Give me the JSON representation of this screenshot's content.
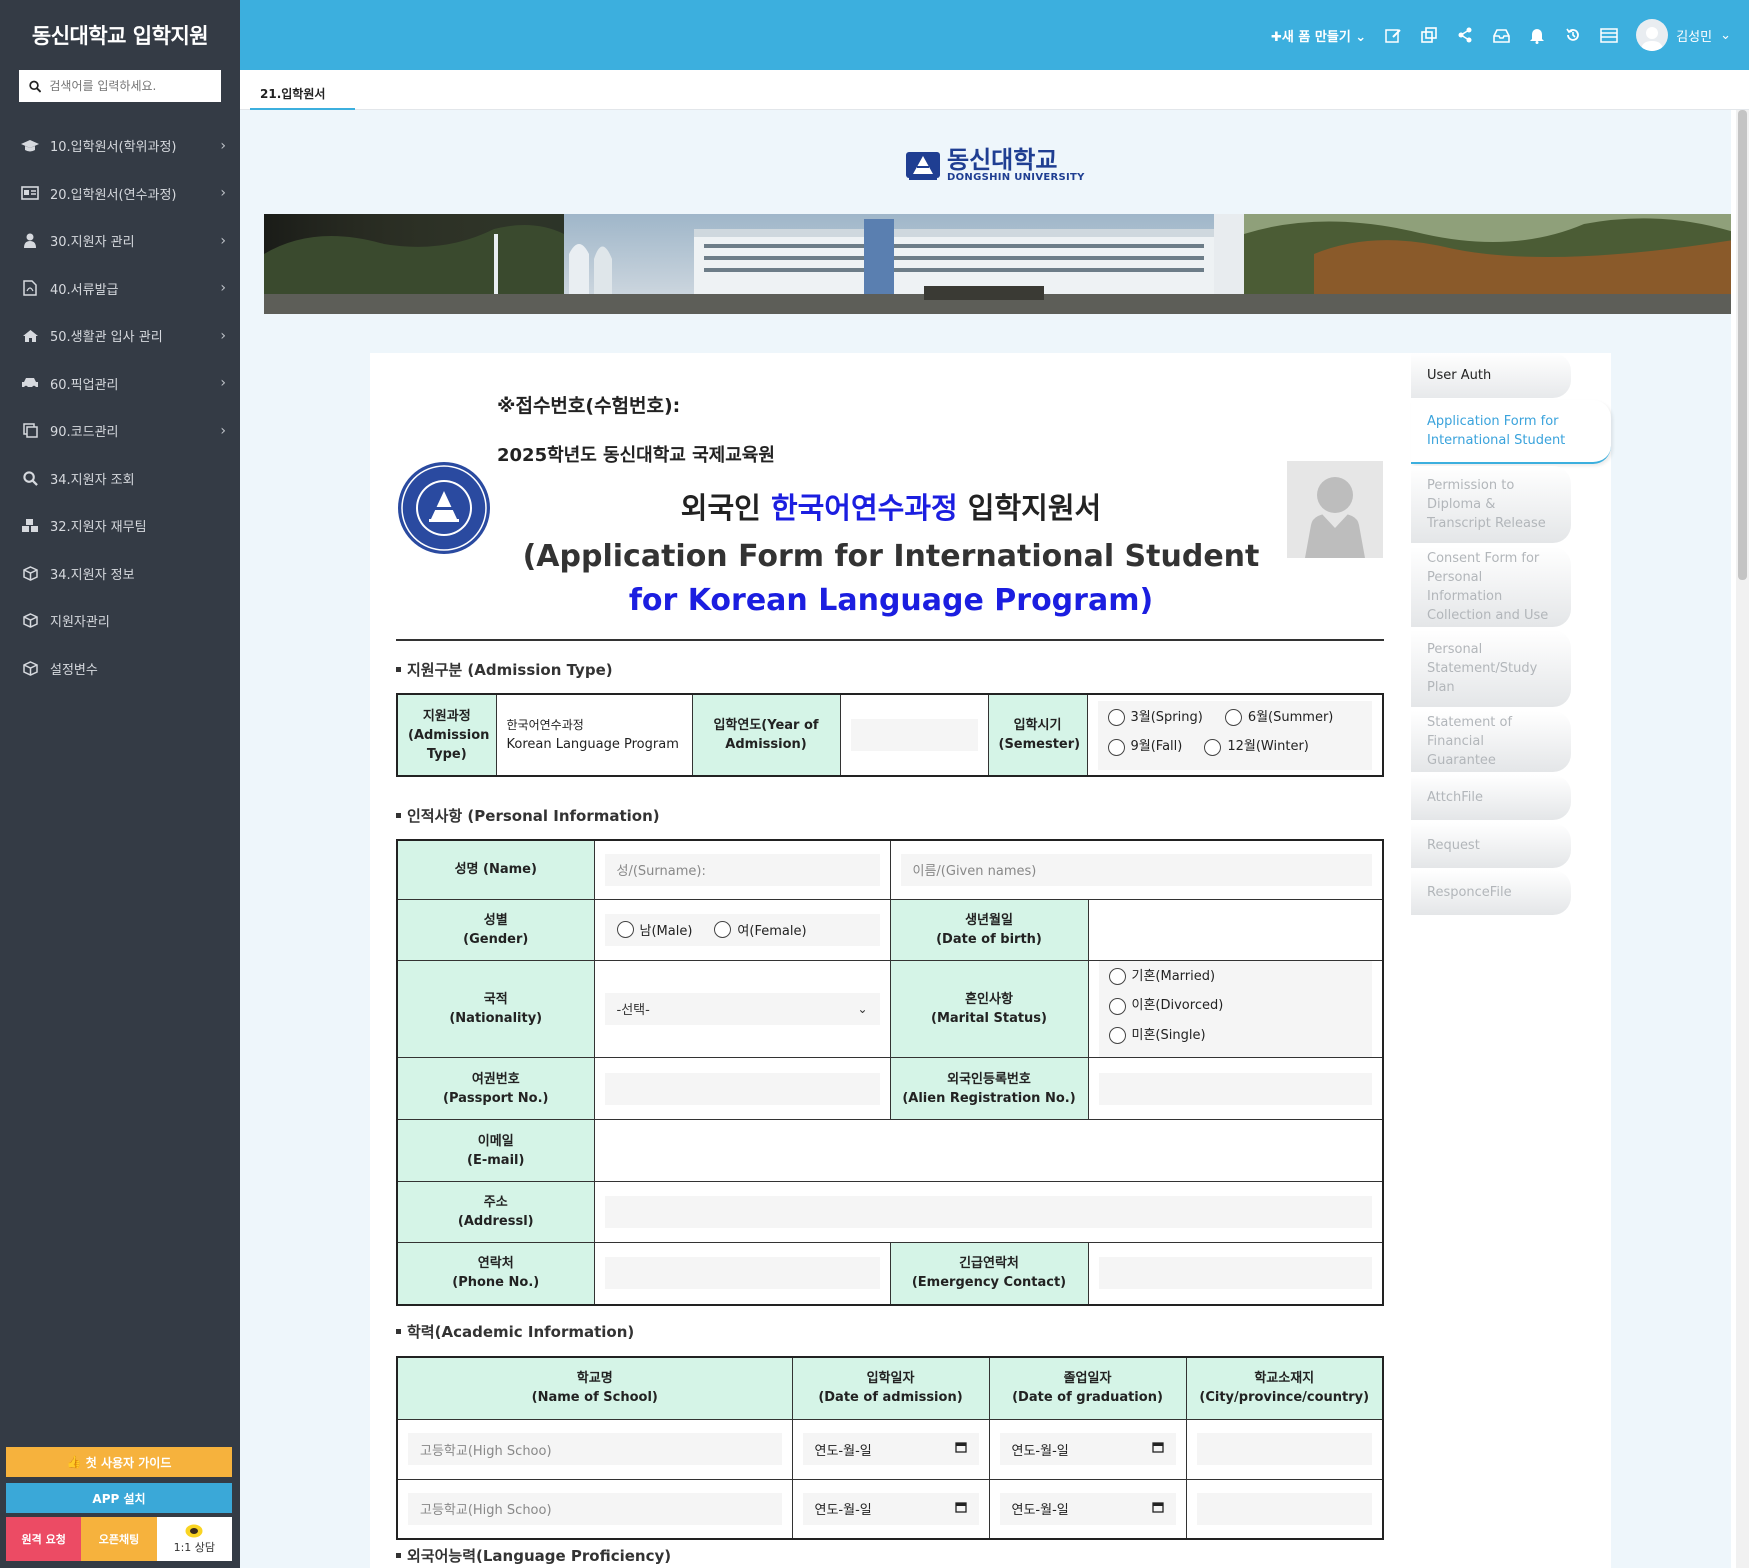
{
  "sidebar": {
    "brand": "동신대학교 입학지원",
    "search_placeholder": "검색어를 입력하세요.",
    "items": [
      {
        "label": "10.입학원서(학위과정)",
        "icon": "graduation-cap-icon",
        "chevron": true
      },
      {
        "label": "20.입학원서(연수과정)",
        "icon": "id-card-icon",
        "chevron": true
      },
      {
        "label": "30.지원자 관리",
        "icon": "user-icon",
        "chevron": true
      },
      {
        "label": "40.서류발급",
        "icon": "pdf-file-icon",
        "chevron": true
      },
      {
        "label": "50.생활관 입사 관리",
        "icon": "home-icon",
        "chevron": true
      },
      {
        "label": "60.픽업관리",
        "icon": "car-icon",
        "chevron": true
      },
      {
        "label": "90.코드관리",
        "icon": "copy-icon",
        "chevron": true
      },
      {
        "label": "34.지원자 조회",
        "icon": "search-icon",
        "chevron": false
      },
      {
        "label": "32.지원자 재무팀",
        "icon": "cubes-icon",
        "chevron": false
      },
      {
        "label": "34.지원자 정보",
        "icon": "cube-icon",
        "chevron": false
      },
      {
        "label": "지원자관리",
        "icon": "cube-icon",
        "chevron": false
      },
      {
        "label": "설정변수",
        "icon": "cube-icon",
        "chevron": false
      }
    ],
    "guide_button": "첫 사용자 가이드",
    "app_button": "APP 설치",
    "remote_button": "원격 요청",
    "chat_button": "오픈채팅",
    "consult_button": "1:1 상담"
  },
  "header": {
    "new_form": "새 폼 만들기",
    "user_name": "김성민"
  },
  "tabs": {
    "active": "21.입학원서"
  },
  "logo": {
    "kr": "동신대학교",
    "en": "DONGSHIN UNIVERSITY"
  },
  "form": {
    "receipt_label": "※접수번호(수험번호):",
    "year_line": "2025학년도 동신대학교 국제교육원",
    "title_part1": "외국인 ",
    "title_highlight": "한국어연수과정",
    "title_part2": " 입학지원서",
    "title_en1": "(Application Form for International Student",
    "title_en2": "for Korean Language Program)",
    "admission": {
      "section_title": "지원구분 (Admission Type)",
      "type_header": "지원과정\n(Admission\nType)",
      "type_value_kr": "한국어연수과정",
      "type_value_en": "Korean Language Program",
      "year_header": "입학연도(Year of\nAdmission)",
      "year_value": "",
      "semester_header": "입학시기\n(Semester)",
      "semesters": [
        "3월(Spring)",
        "6월(Summer)",
        "9월(Fall)",
        "12월(Winter)"
      ]
    },
    "personal": {
      "section_title": "인적사항 (Personal Information)",
      "name_header": "성명 (Name)",
      "surname_placeholder": "성/(Surname):",
      "given_placeholder": "이름/(Given names)",
      "gender_header": "성별\n(Gender)",
      "genders": [
        "남(Male)",
        "여(Female)"
      ],
      "dob_header": "생년월일\n(Date of birth)",
      "nationality_header": "국적\n(Nationality)",
      "nationality_value": "-선택-",
      "marital_header": "혼인사항\n(Marital Status)",
      "marital_options": [
        "기혼(Married)",
        "이혼(Divorced)",
        "미혼(Single)"
      ],
      "passport_header": "여권번호\n(Passport No.)",
      "alien_header": "외국인등록번호\n(Alien Registration No.)",
      "email_header": "이메일\n(E-mail)",
      "address_header": "주소\n(Addressl)",
      "phone_header": "연락처\n(Phone No.)",
      "emergency_header": "긴급연락처\n(Emergency Contact)"
    },
    "academic": {
      "section_title": "학력(Academic Information)",
      "headers": [
        "학교명\n(Name of School)",
        "입학일자\n(Date of admission)",
        "졸업일자\n(Date of graduation)",
        "학교소재지\n(City/province/country)"
      ],
      "rows": [
        {
          "school_placeholder": "고등학교(High Schoo)",
          "admission_date": "연도-월-일",
          "graduation_date": "연도-월-일"
        },
        {
          "school_placeholder": "고등학교(High Schoo)",
          "admission_date": "연도-월-일",
          "graduation_date": "연도-월-일"
        }
      ]
    },
    "next_section_partial": "외국어능력(Language Proficiency)"
  },
  "side_nav": {
    "items": [
      {
        "label": "User Auth",
        "state": "first"
      },
      {
        "label": "Application Form for International Student",
        "state": "active"
      },
      {
        "label": "Permission to Diploma & Transcript Release",
        "state": "disabled"
      },
      {
        "label": "Consent Form for Personal Information Collection and Use",
        "state": "disabled"
      },
      {
        "label": "Personal Statement/Study Plan",
        "state": "disabled"
      },
      {
        "label": "Statement of Financial Guarantee",
        "state": "disabled"
      },
      {
        "label": "AttchFile",
        "state": "disabled"
      },
      {
        "label": "Request",
        "state": "disabled"
      },
      {
        "label": "ResponceFile",
        "state": "disabled"
      }
    ]
  },
  "colors": {
    "sidebar_bg": "#343b45",
    "header_bg": "#3cafde",
    "table_header_bg": "#d5f4e7",
    "highlight_blue": "#1b1ee0"
  }
}
